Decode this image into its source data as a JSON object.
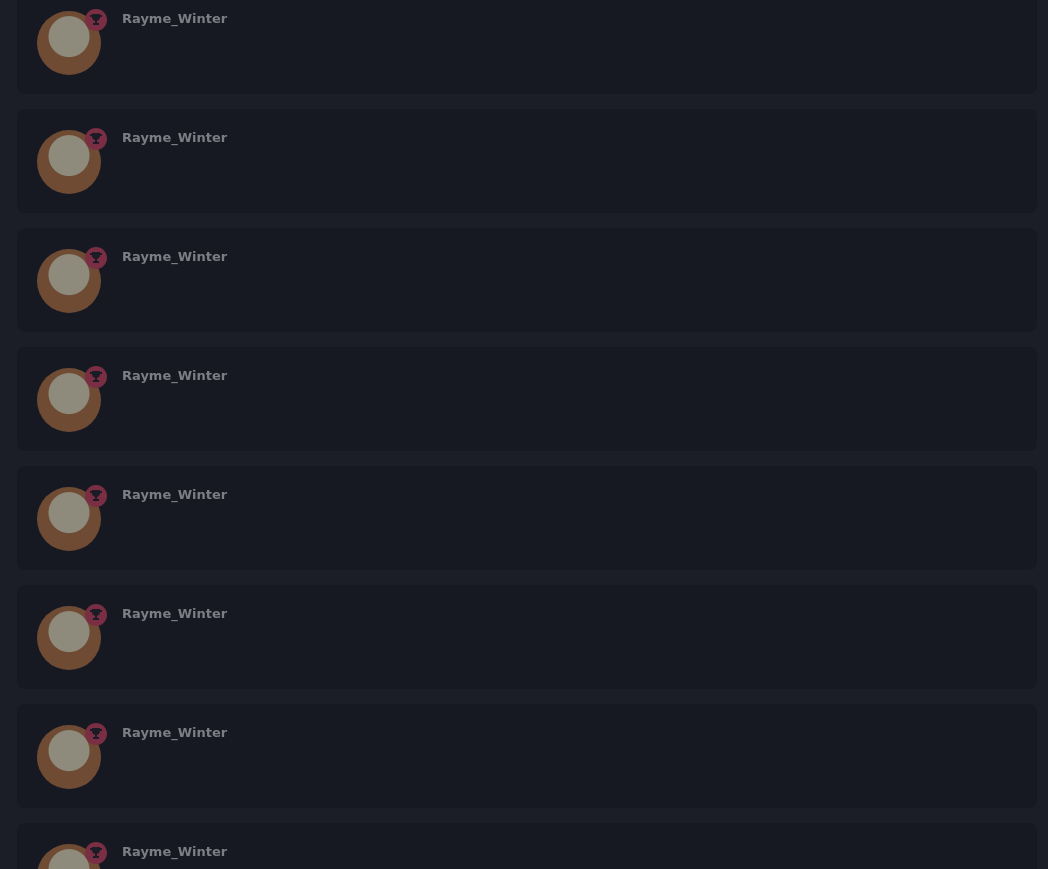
{
  "posts": [
    {
      "username": "Rayme_Winter"
    },
    {
      "username": "Rayme_Winter"
    },
    {
      "username": "Rayme_Winter"
    },
    {
      "username": "Rayme_Winter"
    },
    {
      "username": "Rayme_Winter"
    },
    {
      "username": "Rayme_Winter"
    },
    {
      "username": "Rayme_Winter"
    },
    {
      "username": "Rayme_Winter"
    }
  ]
}
